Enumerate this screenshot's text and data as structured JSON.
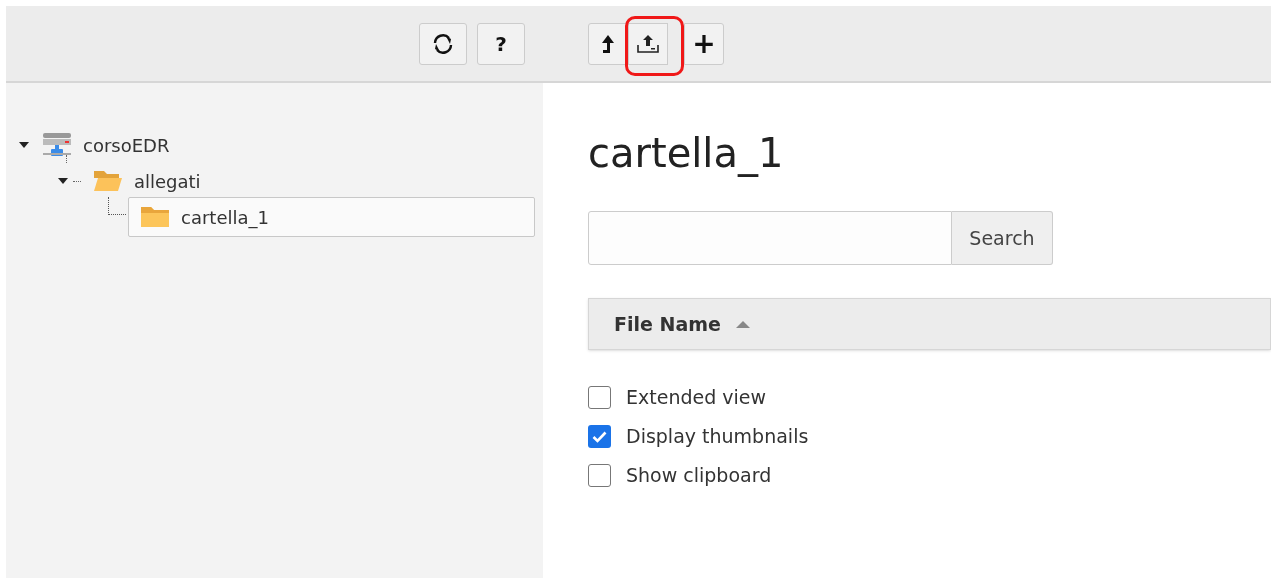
{
  "toolbar": {
    "left_buttons": [
      {
        "kind": "refresh"
      },
      {
        "kind": "text",
        "label": "?"
      }
    ],
    "right_buttons": [
      {
        "kind": "up",
        "highlighted": false
      },
      {
        "kind": "upload",
        "highlighted": true
      },
      {
        "kind": "text",
        "label": "+",
        "highlighted": false
      }
    ]
  },
  "tree": [
    {
      "label": "corsoEDR",
      "kind": "server",
      "expanded": true,
      "selected": false,
      "children": [
        {
          "label": "allegati",
          "kind": "folder",
          "expanded": true,
          "selected": false,
          "children": [
            {
              "label": "cartella_1",
              "kind": "folder",
              "selected": true
            }
          ]
        }
      ]
    }
  ],
  "heading": "cartella_1",
  "search": {
    "button": "Search"
  },
  "table": {
    "columns": [
      {
        "label": "File Name",
        "sort_ascending": true
      }
    ]
  },
  "options": [
    {
      "label": "Extended view",
      "checked": false
    },
    {
      "label": "Display thumbnails",
      "checked": true
    },
    {
      "label": "Show clipboard",
      "checked": false
    }
  ]
}
